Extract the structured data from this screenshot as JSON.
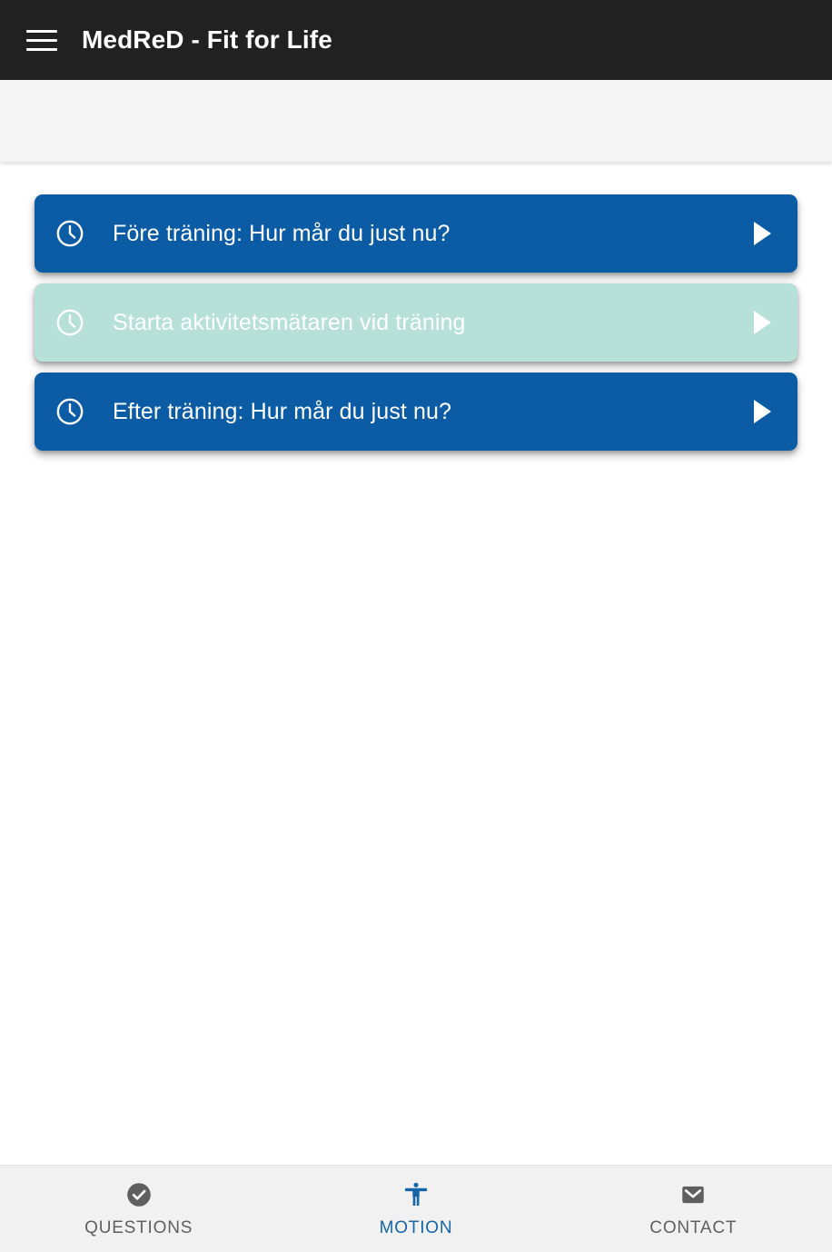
{
  "appbar": {
    "menu_icon": "hamburger-menu-icon",
    "title": "MedReD - Fit for Life"
  },
  "colors": {
    "appbar_bg": "#212121",
    "subbar_bg": "#f5f5f5",
    "card_enabled_bg": "#0b5ca5",
    "card_disabled_bg": "#b6e0d8",
    "card_text": "#ffffff",
    "nav_bg": "#f1f1f1",
    "nav_active": "#1565a8",
    "nav_inactive": "#5f5f5f"
  },
  "main": {
    "cards": [
      {
        "icon": "clock-icon",
        "label": "Före träning: Hur mår du just nu?",
        "arrow": "play-triangle-icon",
        "state": "enabled"
      },
      {
        "icon": "clock-icon",
        "label": "Starta aktivitetsmätaren vid träning",
        "arrow": "play-triangle-icon",
        "state": "disabled"
      },
      {
        "icon": "clock-icon",
        "label": "Efter träning: Hur mår du just nu?",
        "arrow": "play-triangle-icon",
        "state": "enabled"
      }
    ]
  },
  "bottom_nav": {
    "items": [
      {
        "icon": "check-circle-icon",
        "label": "QUESTIONS",
        "active": false
      },
      {
        "icon": "accessibility-person-icon",
        "label": "MOTION",
        "active": true
      },
      {
        "icon": "envelope-icon",
        "label": "CONTACT",
        "active": false
      }
    ]
  }
}
